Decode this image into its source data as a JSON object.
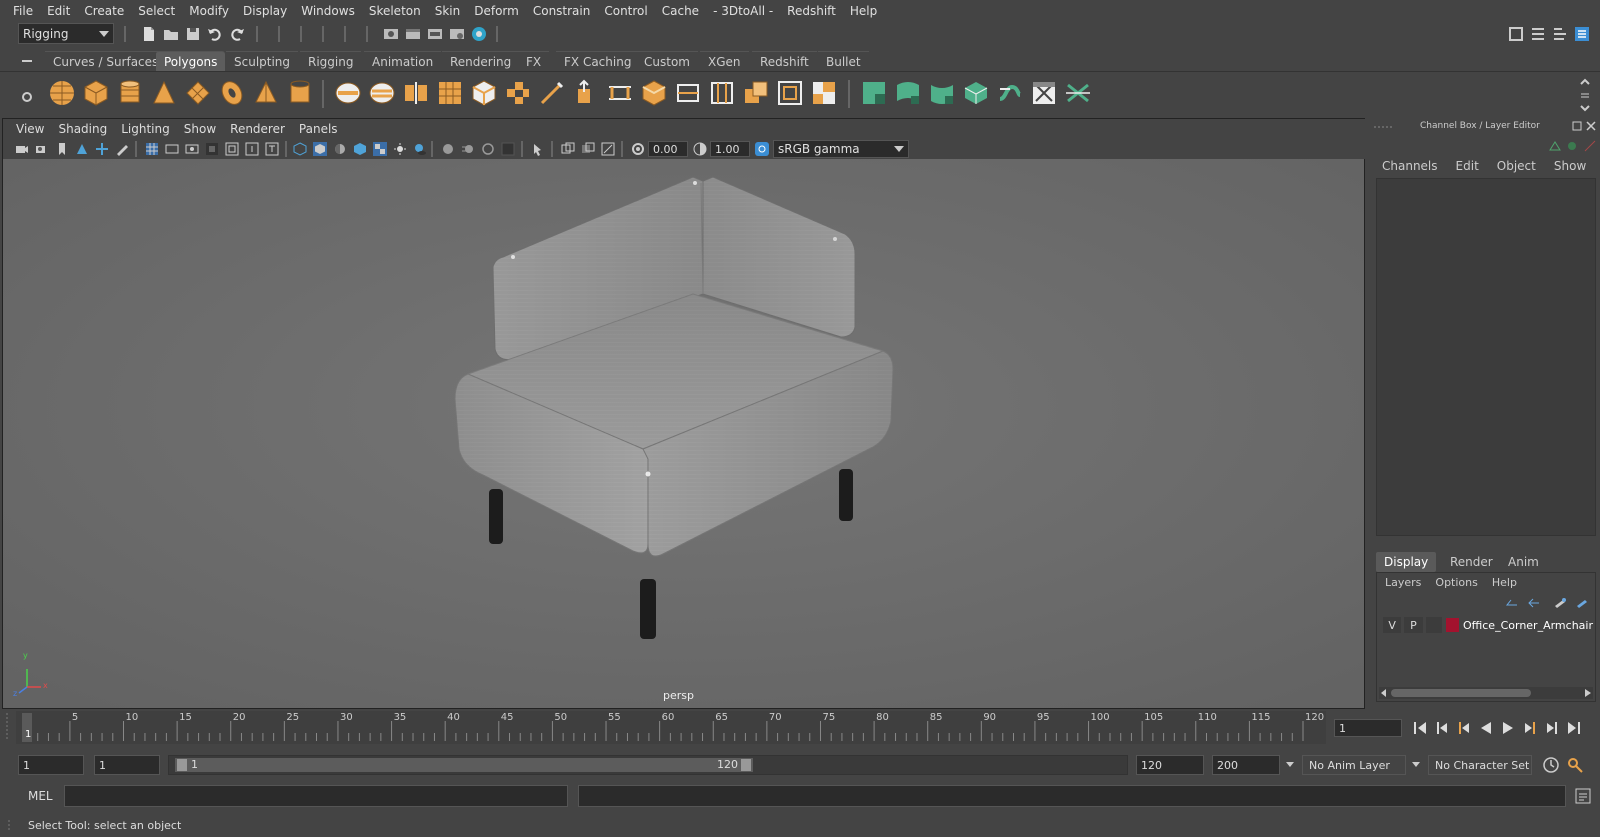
{
  "menubar": {
    "items": [
      "File",
      "Edit",
      "Create",
      "Select",
      "Modify",
      "Display",
      "Windows",
      "Skeleton",
      "Skin",
      "Deform",
      "Constrain",
      "Control",
      "Cache",
      "- 3DtoAll -",
      "Redshift",
      "Help"
    ]
  },
  "statusline": {
    "menuset": "Rigging"
  },
  "shelf": {
    "tabs": [
      "Curves / Surfaces",
      "Polygons",
      "Sculpting",
      "Rigging",
      "Animation",
      "Rendering",
      "FX",
      "FX Caching",
      "Custom",
      "XGen",
      "Redshift",
      "Bullet"
    ],
    "active_tab": "Polygons"
  },
  "viewport": {
    "menu": [
      "View",
      "Shading",
      "Lighting",
      "Show",
      "Renderer",
      "Panels"
    ],
    "exposure": "0.00",
    "gamma": "1.00",
    "colorspace": "sRGB gamma",
    "camera_label": "persp",
    "axis": {
      "x": "x",
      "y": "y",
      "z": "z"
    }
  },
  "channelbox": {
    "title": "Channel Box / Layer Editor",
    "menu": [
      "Channels",
      "Edit",
      "Object",
      "Show"
    ]
  },
  "layereditor": {
    "tabs": [
      "Display",
      "Render",
      "Anim"
    ],
    "active_tab": "Display",
    "menu": [
      "Layers",
      "Options",
      "Help"
    ],
    "layer": {
      "v": "V",
      "p": "P",
      "name": "Office_Corner_Armchair",
      "color": "#a3122e"
    }
  },
  "timeslider": {
    "ticks": [
      "1",
      "5",
      "10",
      "15",
      "20",
      "25",
      "30",
      "35",
      "40",
      "45",
      "50",
      "55",
      "60",
      "65",
      "70",
      "75",
      "80",
      "85",
      "90",
      "95",
      "100",
      "105",
      "110",
      "115",
      "120"
    ],
    "current_frame": "1"
  },
  "rangeslider": {
    "start": "1",
    "anim_start": "1",
    "range_start_label": "1",
    "range_end_label": "120",
    "playback_end": "120",
    "anim_end": "200",
    "anim_layer": "No Anim Layer",
    "char_set": "No Character Set"
  },
  "cmdline": {
    "label": "MEL"
  },
  "helpline": {
    "text": "Select Tool: select an object"
  },
  "colors": {
    "shelf_orange": "#e8a24a",
    "shelf_green": "#4fb08a",
    "layer_red": "#a3122e"
  }
}
